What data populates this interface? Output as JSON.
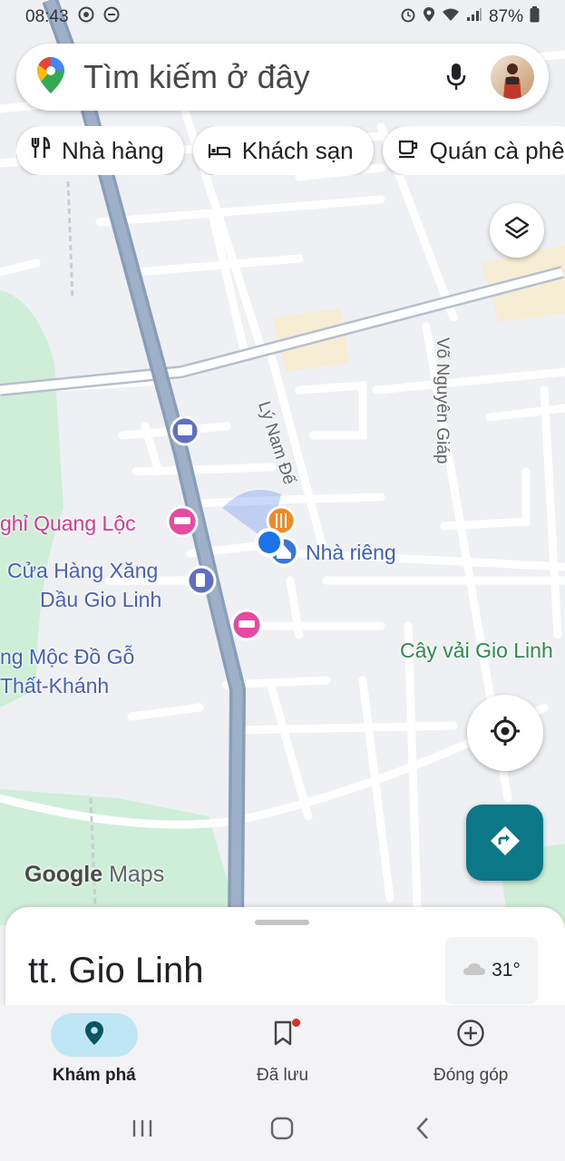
{
  "status_bar": {
    "time": "08:43",
    "battery": "87%"
  },
  "search": {
    "placeholder": "Tìm kiếm ở đây"
  },
  "chips": [
    {
      "label": "Nhà hàng",
      "icon": "fork-knife-icon"
    },
    {
      "label": "Khách sạn",
      "icon": "bed-icon"
    },
    {
      "label": "Quán cà phê",
      "icon": "coffee-icon"
    }
  ],
  "map": {
    "streets": {
      "ly_nam_de": "Lý Nam Đế",
      "vo_nguyen_giap": "Võ Nguyên Giáp"
    },
    "places": {
      "guesthouse": "ghỉ Quang Lộc",
      "gas_line1": "Cửa Hàng Xăng",
      "gas_line2": "Dầu Gio Linh",
      "wood_line1": "ng Mộc Đồ Gỗ",
      "wood_line2": "Thất-Khánh",
      "lychee": "Cây vải Gio Linh",
      "home": "Nhà riêng"
    },
    "logo_google": "Google",
    "logo_maps": "Maps"
  },
  "sheet": {
    "title": "tt. Gio Linh",
    "temperature": "31°"
  },
  "nav": [
    {
      "label": "Khám phá",
      "icon": "explore-pin-icon",
      "active": true
    },
    {
      "label": "Đã lưu",
      "icon": "bookmark-icon",
      "active": false
    },
    {
      "label": "Đóng góp",
      "icon": "add-circle-icon",
      "active": false
    }
  ],
  "colors": {
    "accent_teal": "#0b7787",
    "route_blue": "#8aa0c2",
    "poi_pink": "#e94aa1",
    "poi_blue": "#5f6fc4",
    "location_blue": "#1a73e8"
  }
}
